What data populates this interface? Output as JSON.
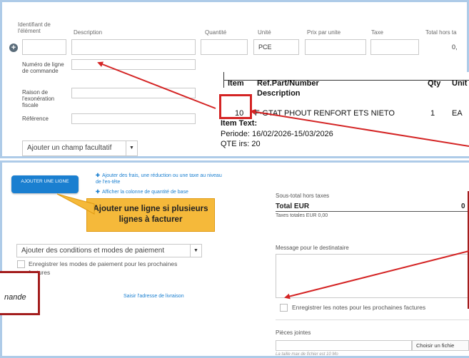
{
  "line_items": {
    "headers": {
      "item_id": "Identifiant de l'élément",
      "description": "Description",
      "quantity": "Quantité",
      "unit": "Unité",
      "unit_price": "Prix par unite",
      "tax": "Taxe",
      "total": "Total hors ta"
    },
    "row": {
      "item_id": "",
      "description": "",
      "quantity": "",
      "unit": "PCE",
      "unit_price": "",
      "tax": "",
      "total": "0,"
    },
    "extra_fields": {
      "order_line_label": "Numéro de ligne de commande",
      "tax_exemption_label": "Raison de l'exonération fiscale",
      "reference_label": "Référence"
    },
    "add_optional_field": "Ajouter un champ facultatif"
  },
  "doc_excerpt": {
    "col_item": "Item",
    "col_ref": "Ref.Part/Number",
    "col_desc": "Description",
    "col_qty": "Qty",
    "col_unit": "Unit",
    "item_no": "10",
    "ref": "F-GTAT PHOUT RENFORT ETS NIETO",
    "qty": "1",
    "unit": "EA",
    "text_label": "Item Text:",
    "period": "Periode: 16/02/2026-15/03/2026",
    "qte": "QTE irs: 20"
  },
  "actions": {
    "add_line": "AJOUTER UNE LIGNE",
    "add_fees": "Ajouter des frais, une réduction ou une taxe au niveau de l'en-tête",
    "show_base_qty": "Afficher la colonne de quantité de base"
  },
  "callout": "Ajouter une ligne si plusieurs lignes à facturer",
  "payment": {
    "select_label": "Ajouter des conditions et modes de paiement",
    "save_payment": "Enregistrer les modes de paiement pour les prochaines factures",
    "shipping_link": "Saisir l'adresse de livraison"
  },
  "side_note": "nande",
  "totals": {
    "subtotal_label": "Sous-total hors taxes",
    "total_label": "Total EUR",
    "total_value": "0",
    "taxes_label": "Taxes totales EUR 0,00"
  },
  "message": {
    "label": "Message pour le destinataire",
    "save_notes": "Enregistrer les notes pour les prochaines factures"
  },
  "attachments": {
    "label": "Pièces jointes",
    "choose_file": "Choisir un fichie",
    "max_size": "La taille max de fichier est 10 Mo"
  },
  "colors": {
    "accent": "#1a7fd0",
    "callout": "#f5b93a",
    "highlight_red": "#d42424",
    "panel_border": "#aecbe8"
  }
}
